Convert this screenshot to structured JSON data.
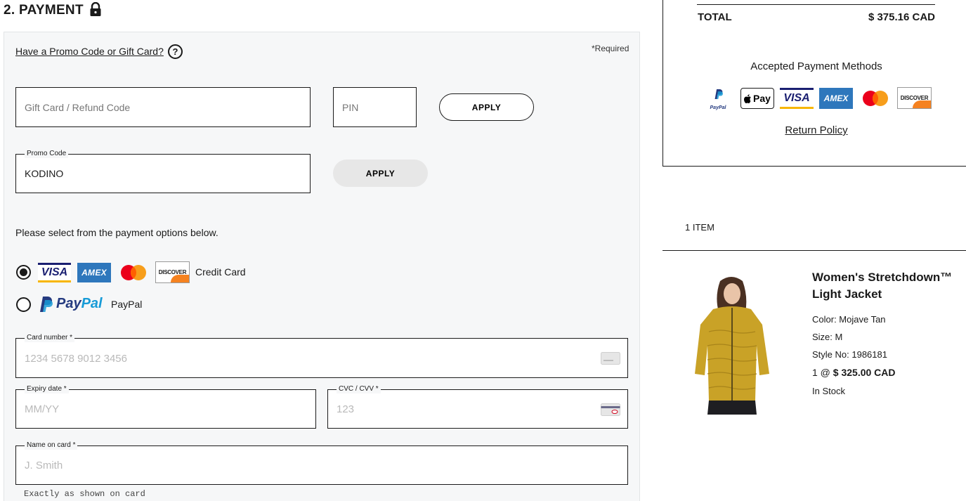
{
  "payment": {
    "heading": "2. PAYMENT",
    "promo_link": "Have a Promo Code or Gift Card?",
    "required_note": "*Required",
    "gift_card_placeholder": "Gift Card / Refund Code",
    "pin_placeholder": "PIN",
    "apply_gift_label": "APPLY",
    "promo_code_legend": "Promo Code",
    "promo_code_value": "KODINO",
    "apply_promo_label": "APPLY",
    "instructions": "Please select from the payment options below.",
    "options": [
      {
        "label": "Credit Card",
        "selected": true
      },
      {
        "label": "PayPal",
        "selected": false
      }
    ],
    "card_logos": {
      "visa": "VISA",
      "amex": "AMEX",
      "discover": "DISCOVER",
      "paypal_brand_pay": "Pay",
      "paypal_brand_pal": "Pal"
    },
    "card_number": {
      "legend": "Card number *",
      "placeholder": "1234 5678 9012 3456"
    },
    "expiry": {
      "legend": "Expiry date *",
      "placeholder": "MM/YY"
    },
    "cvc": {
      "legend": "CVC / CVV *",
      "placeholder": "123"
    },
    "name_on_card": {
      "legend": "Name on card *",
      "placeholder": "J. Smith",
      "hint": "Exactly as shown on card"
    }
  },
  "summary": {
    "total_label": "TOTAL",
    "total_value": "$ 375.16 CAD",
    "accepted_methods_title": "Accepted Payment Methods",
    "methods": {
      "paypal_small": "PayPal",
      "applepay": "Pay",
      "visa": "VISA",
      "amex": "AMEX",
      "discover": "DISCOVER"
    },
    "return_policy": "Return Policy"
  },
  "cart": {
    "items_count": "1 ITEM",
    "product": {
      "name": "Women's Stretchdown™ Light Jacket",
      "color": "Color: Mojave Tan",
      "size": "Size: M",
      "style": "Style No: 1986181",
      "qty_prefix": "1 @ ",
      "price": "$ 325.00 CAD",
      "stock": "In Stock"
    }
  },
  "colors": {
    "accent": "#1a1a1a",
    "panel_bg": "#f6f7f8",
    "visa_blue": "#1a1f71",
    "visa_gold": "#f7b600",
    "amex_blue": "#2e77bc",
    "mc_red": "#eb001b",
    "mc_orange": "#f79e1b",
    "discover_orange": "#f58220",
    "paypal_dark": "#253b80",
    "paypal_light": "#179bd7",
    "jacket": "#c9a227"
  },
  "icons": [
    "lock-icon",
    "help-icon",
    "credit-card-icon",
    "cvc-card-icon"
  ]
}
